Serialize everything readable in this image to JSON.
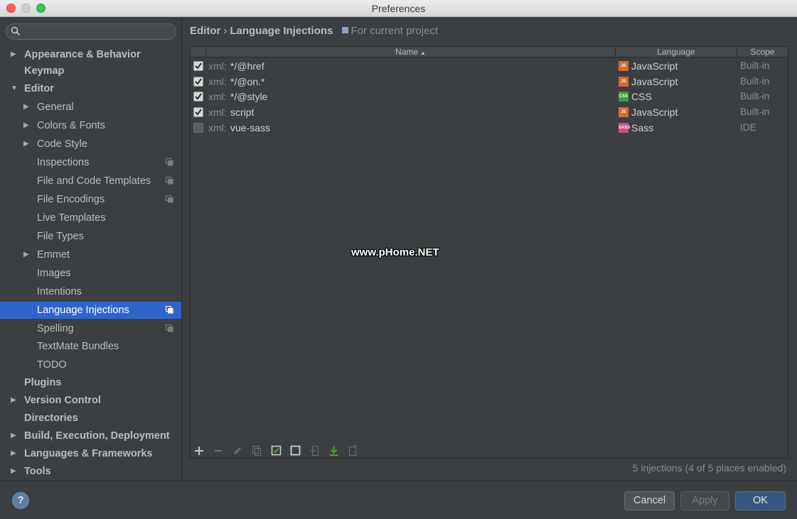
{
  "window": {
    "title": "Preferences"
  },
  "sidebar": {
    "search_placeholder": "",
    "items": [
      {
        "label": "Appearance & Behavior",
        "bold": true,
        "arrow": "▶",
        "level": 0
      },
      {
        "label": "Keymap",
        "bold": true,
        "arrow": "",
        "level": 0
      },
      {
        "label": "Editor",
        "bold": true,
        "arrow": "▼",
        "level": 0
      },
      {
        "label": "General",
        "bold": false,
        "arrow": "▶",
        "level": 1
      },
      {
        "label": "Colors & Fonts",
        "bold": false,
        "arrow": "▶",
        "level": 1
      },
      {
        "label": "Code Style",
        "bold": false,
        "arrow": "▶",
        "level": 1
      },
      {
        "label": "Inspections",
        "bold": false,
        "arrow": "",
        "level": 1,
        "project": true
      },
      {
        "label": "File and Code Templates",
        "bold": false,
        "arrow": "",
        "level": 1,
        "project": true
      },
      {
        "label": "File Encodings",
        "bold": false,
        "arrow": "",
        "level": 1,
        "project": true
      },
      {
        "label": "Live Templates",
        "bold": false,
        "arrow": "",
        "level": 1
      },
      {
        "label": "File Types",
        "bold": false,
        "arrow": "",
        "level": 1
      },
      {
        "label": "Emmet",
        "bold": false,
        "arrow": "▶",
        "level": 1
      },
      {
        "label": "Images",
        "bold": false,
        "arrow": "",
        "level": 1
      },
      {
        "label": "Intentions",
        "bold": false,
        "arrow": "",
        "level": 1
      },
      {
        "label": "Language Injections",
        "bold": false,
        "arrow": "",
        "level": 1,
        "project": true,
        "selected": true
      },
      {
        "label": "Spelling",
        "bold": false,
        "arrow": "",
        "level": 1,
        "project": true
      },
      {
        "label": "TextMate Bundles",
        "bold": false,
        "arrow": "",
        "level": 1
      },
      {
        "label": "TODO",
        "bold": false,
        "arrow": "",
        "level": 1
      },
      {
        "label": "Plugins",
        "bold": true,
        "arrow": "",
        "level": 0
      },
      {
        "label": "Version Control",
        "bold": true,
        "arrow": "▶",
        "level": 0
      },
      {
        "label": "Directories",
        "bold": true,
        "arrow": "",
        "level": 0
      },
      {
        "label": "Build, Execution, Deployment",
        "bold": true,
        "arrow": "▶",
        "level": 0
      },
      {
        "label": "Languages & Frameworks",
        "bold": true,
        "arrow": "▶",
        "level": 0
      },
      {
        "label": "Tools",
        "bold": true,
        "arrow": "▶",
        "level": 0
      }
    ]
  },
  "header": {
    "breadcrumb_parent": "Editor",
    "breadcrumb_sep": "›",
    "breadcrumb_current": "Language Injections",
    "scope_label": "For current project"
  },
  "table": {
    "columns": {
      "name": "Name",
      "language": "Language",
      "scope": "Scope"
    },
    "rows": [
      {
        "checked": true,
        "prefix": "xml:",
        "name": "*/@href",
        "language": "JavaScript",
        "lang_icon": "JS",
        "lang_color": "#d86a32",
        "scope": "Built-in"
      },
      {
        "checked": true,
        "prefix": "xml:",
        "name": "*/@on.*",
        "language": "JavaScript",
        "lang_icon": "JS",
        "lang_color": "#d86a32",
        "scope": "Built-in"
      },
      {
        "checked": true,
        "prefix": "xml:",
        "name": "*/@style",
        "language": "CSS",
        "lang_icon": "CSS",
        "lang_color": "#3b9c3b",
        "scope": "Built-in"
      },
      {
        "checked": true,
        "prefix": "xml:",
        "name": "script",
        "language": "JavaScript",
        "lang_icon": "JS",
        "lang_color": "#d86a32",
        "scope": "Built-in"
      },
      {
        "checked": false,
        "prefix": "xml:",
        "name": "vue-sass",
        "language": "Sass",
        "lang_icon": "SASS",
        "lang_color": "#c6538c",
        "scope": "IDE"
      }
    ]
  },
  "toolbar": {
    "icons": [
      "add-icon",
      "remove-icon",
      "edit-icon",
      "copy-icon",
      "toggle-enabled-icon",
      "duplicate-icon",
      "import-icon",
      "export-icon",
      "share-icon"
    ]
  },
  "status": {
    "text": "5 injections (4 of 5 places enabled)"
  },
  "footer": {
    "help": "?",
    "cancel": "Cancel",
    "apply": "Apply",
    "ok": "OK"
  },
  "watermark": {
    "text": "www.pHome.NET"
  }
}
